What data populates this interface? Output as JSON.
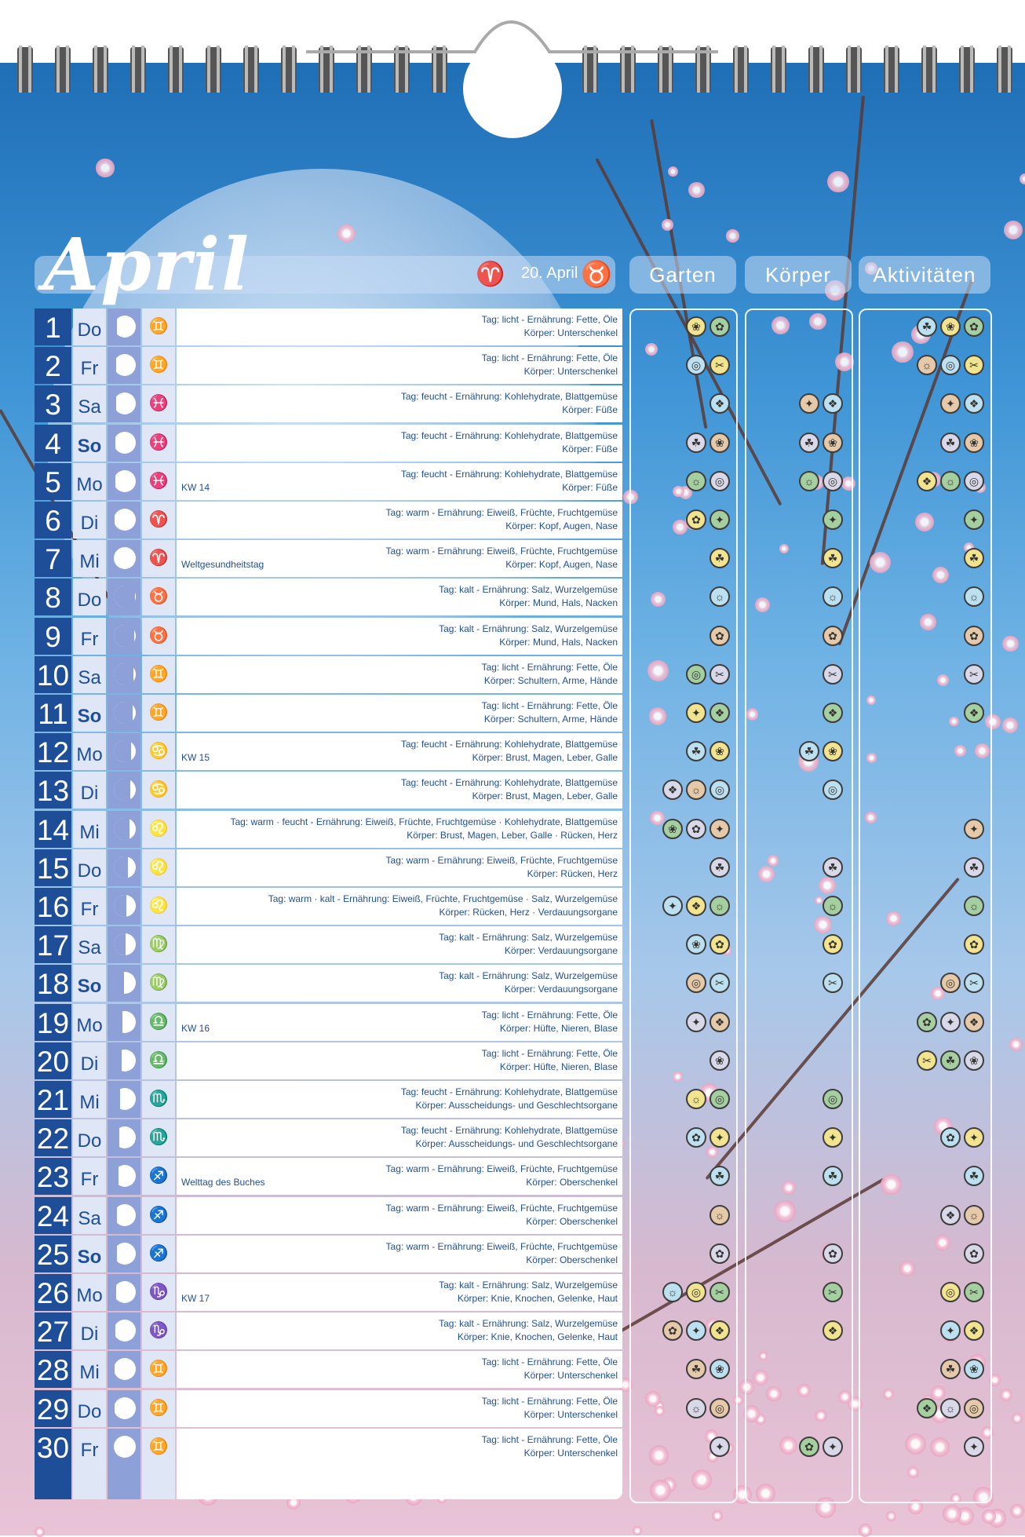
{
  "month": "April",
  "sign_change": "20. April",
  "columns": {
    "garden": "Garten",
    "body": "Körper",
    "activities": "Aktivitäten"
  },
  "colors": {
    "accent": "#1f4e99",
    "sky": "#3f95d6",
    "blossom": "#e39ab9"
  },
  "days": [
    {
      "n": "1",
      "wd": "Do",
      "phase": 0.85,
      "zod": "zwilling",
      "event": "",
      "l1": "Tag: licht - Ernährung: Fette, Öle",
      "l2": "Körper: Unterschenkel",
      "g": 2,
      "b": 0,
      "a": 3
    },
    {
      "n": "2",
      "wd": "Fr",
      "phase": 0.88,
      "zod": "zwilling",
      "event": "",
      "l1": "Tag: licht - Ernährung: Fette, Öle",
      "l2": "Körper: Unterschenkel",
      "g": 2,
      "b": 0,
      "a": 3
    },
    {
      "n": "3",
      "wd": "Sa",
      "phase": 0.9,
      "zod": "fische",
      "event": "",
      "l1": "Tag: feucht - Ernährung: Kohlehydrate, Blattgemüse",
      "l2": "Körper: Füße",
      "g": 1,
      "b": 2,
      "a": 2
    },
    {
      "n": "4",
      "wd": "So",
      "phase": 0.92,
      "zod": "fische",
      "event": "",
      "l1": "Tag: feucht - Ernährung: Kohlehydrate, Blattgemüse",
      "l2": "Körper: Füße",
      "g": 2,
      "b": 2,
      "a": 2
    },
    {
      "n": "5",
      "wd": "Mo",
      "phase": 0.94,
      "zod": "fische",
      "event": "KW 14",
      "l1": "Tag: feucht - Ernährung: Kohlehydrate, Blattgemüse",
      "l2": "Körper: Füße",
      "g": 2,
      "b": 2,
      "a": 3
    },
    {
      "n": "6",
      "wd": "Di",
      "phase": 0.96,
      "zod": "widder",
      "event": "",
      "l1": "Tag: warm - Ernährung: Eiweiß, Früchte, Fruchtgemüse",
      "l2": "Körper: Kopf, Augen, Nase",
      "g": 2,
      "b": 1,
      "a": 1
    },
    {
      "n": "7",
      "wd": "Mi",
      "phase": 1.0,
      "zod": "widder",
      "event": "Weltgesundheitstag",
      "l1": "Tag: warm - Ernährung: Eiweiß, Früchte, Fruchtgemüse",
      "l2": "Körper: Kopf, Augen, Nase",
      "g": 1,
      "b": 1,
      "a": 1
    },
    {
      "n": "8",
      "wd": "Do",
      "phase": 0.04,
      "zod": "stier",
      "event": "",
      "l1": "Tag: kalt - Ernährung: Salz, Wurzelgemüse",
      "l2": "Körper: Mund, Hals, Nacken",
      "g": 1,
      "b": 1,
      "a": 1
    },
    {
      "n": "9",
      "wd": "Fr",
      "phase": 0.08,
      "zod": "stier",
      "event": "",
      "l1": "Tag: kalt - Ernährung: Salz, Wurzelgemüse",
      "l2": "Körper: Mund, Hals, Nacken",
      "g": 1,
      "b": 1,
      "a": 1
    },
    {
      "n": "10",
      "wd": "Sa",
      "phase": 0.12,
      "zod": "zwilling",
      "event": "",
      "l1": "Tag: licht - Ernährung: Fette, Öle",
      "l2": "Körper: Schultern, Arme, Hände",
      "g": 2,
      "b": 1,
      "a": 1
    },
    {
      "n": "11",
      "wd": "So",
      "phase": 0.16,
      "zod": "zwilling",
      "event": "",
      "l1": "Tag: licht - Ernährung: Fette, Öle",
      "l2": "Körper: Schultern, Arme, Hände",
      "g": 2,
      "b": 1,
      "a": 1
    },
    {
      "n": "12",
      "wd": "Mo",
      "phase": 0.2,
      "zod": "krebs",
      "event": "KW 15",
      "l1": "Tag: feucht - Ernährung: Kohlehydrate, Blattgemüse",
      "l2": "Körper: Brust, Magen, Leber, Galle",
      "g": 2,
      "b": 2,
      "a": 0
    },
    {
      "n": "13",
      "wd": "Di",
      "phase": 0.25,
      "zod": "krebs",
      "event": "",
      "l1": "Tag: feucht - Ernährung: Kohlehydrate, Blattgemüse",
      "l2": "Körper: Brust, Magen, Leber, Galle",
      "g": 3,
      "b": 1,
      "a": 0
    },
    {
      "n": "14",
      "wd": "Mi",
      "phase": 0.3,
      "zod": "löwe",
      "event": "",
      "l1": "Tag: warm · feucht - Ernährung: Eiweiß, Früchte, Fruchtgemüse · Kohlehydrate, Blattgemüse",
      "l2": "Körper: Brust, Magen, Leber, Galle · Rücken, Herz",
      "g": 3,
      "b": 0,
      "a": 1
    },
    {
      "n": "15",
      "wd": "Do",
      "phase": 0.36,
      "zod": "löwe",
      "event": "",
      "l1": "Tag: warm - Ernährung: Eiweiß, Früchte, Fruchtgemüse",
      "l2": "Körper: Rücken, Herz",
      "g": 1,
      "b": 1,
      "a": 1
    },
    {
      "n": "16",
      "wd": "Fr",
      "phase": 0.42,
      "zod": "löwe",
      "event": "",
      "l1": "Tag: warm · kalt - Ernährung: Eiweiß, Früchte, Fruchtgemüse · Salz, Wurzelgemüse",
      "l2": "Körper: Rücken, Herz · Verdauungsorgane",
      "g": 3,
      "b": 1,
      "a": 1
    },
    {
      "n": "17",
      "wd": "Sa",
      "phase": 0.48,
      "zod": "jungfrau",
      "event": "",
      "l1": "Tag: kalt - Ernährung: Salz, Wurzelgemüse",
      "l2": "Körper: Verdauungsorgane",
      "g": 2,
      "b": 1,
      "a": 1
    },
    {
      "n": "18",
      "wd": "So",
      "phase": 0.54,
      "zod": "jungfrau",
      "event": "",
      "l1": "Tag: kalt - Ernährung: Salz, Wurzelgemüse",
      "l2": "Körper: Verdauungsorgane",
      "g": 2,
      "b": 1,
      "a": 2
    },
    {
      "n": "19",
      "wd": "Mo",
      "phase": 0.6,
      "zod": "waage",
      "event": "KW 16",
      "l1": "Tag: licht - Ernährung: Fette, Öle",
      "l2": "Körper: Hüfte, Nieren, Blase",
      "g": 2,
      "b": 0,
      "a": 3
    },
    {
      "n": "20",
      "wd": "Di",
      "phase": 0.66,
      "zod": "waage",
      "event": "",
      "l1": "Tag: licht - Ernährung: Fette, Öle",
      "l2": "Körper: Hüfte, Nieren, Blase",
      "g": 1,
      "b": 0,
      "a": 3
    },
    {
      "n": "21",
      "wd": "Mi",
      "phase": 0.72,
      "zod": "skorpion",
      "event": "",
      "l1": "Tag: feucht - Ernährung: Kohlehydrate, Blattgemüse",
      "l2": "Körper: Ausscheidungs- und Geschlechtsorgane",
      "g": 2,
      "b": 1,
      "a": 0
    },
    {
      "n": "22",
      "wd": "Do",
      "phase": 0.76,
      "zod": "skorpion",
      "event": "",
      "l1": "Tag: feucht - Ernährung: Kohlehydrate, Blattgemüse",
      "l2": "Körper: Ausscheidungs- und Geschlechtsorgane",
      "g": 2,
      "b": 1,
      "a": 2
    },
    {
      "n": "23",
      "wd": "Fr",
      "phase": 0.8,
      "zod": "schütze",
      "event": "Welttag des Buches",
      "l1": "Tag: warm - Ernährung: Eiweiß, Früchte, Fruchtgemüse",
      "l2": "Körper: Oberschenkel",
      "g": 1,
      "b": 1,
      "a": 1
    },
    {
      "n": "24",
      "wd": "Sa",
      "phase": 0.84,
      "zod": "schütze",
      "event": "",
      "l1": "Tag: warm - Ernährung: Eiweiß, Früchte, Fruchtgemüse",
      "l2": "Körper: Oberschenkel",
      "g": 1,
      "b": 0,
      "a": 2
    },
    {
      "n": "25",
      "wd": "So",
      "phase": 0.87,
      "zod": "schütze",
      "event": "",
      "l1": "Tag: warm - Ernährung: Eiweiß, Früchte, Fruchtgemüse",
      "l2": "Körper: Oberschenkel",
      "g": 1,
      "b": 1,
      "a": 1
    },
    {
      "n": "26",
      "wd": "Mo",
      "phase": 0.9,
      "zod": "steinbock",
      "event": "KW 17",
      "l1": "Tag: kalt - Ernährung: Salz, Wurzelgemüse",
      "l2": "Körper: Knie, Knochen, Gelenke, Haut",
      "g": 3,
      "b": 1,
      "a": 2
    },
    {
      "n": "27",
      "wd": "Di",
      "phase": 0.93,
      "zod": "steinbock",
      "event": "",
      "l1": "Tag: kalt - Ernährung: Salz, Wurzelgemüse",
      "l2": "Körper: Knie, Knochen, Gelenke, Haut",
      "g": 3,
      "b": 1,
      "a": 2
    },
    {
      "n": "28",
      "wd": "Mi",
      "phase": 0.96,
      "zod": "zwilling",
      "event": "",
      "l1": "Tag: licht - Ernährung: Fette, Öle",
      "l2": "Körper: Unterschenkel",
      "g": 2,
      "b": 0,
      "a": 2
    },
    {
      "n": "29",
      "wd": "Do",
      "phase": 0.98,
      "zod": "zwilling",
      "event": "",
      "l1": "Tag: licht - Ernährung: Fette, Öle",
      "l2": "Körper: Unterschenkel",
      "g": 2,
      "b": 0,
      "a": 3
    },
    {
      "n": "30",
      "wd": "Fr",
      "phase": 0.99,
      "zod": "zwilling",
      "event": "",
      "l1": "Tag: licht - Ernährung: Fette, Öle",
      "l2": "Körper: Unterschenkel",
      "g": 1,
      "b": 2,
      "a": 1
    }
  ]
}
